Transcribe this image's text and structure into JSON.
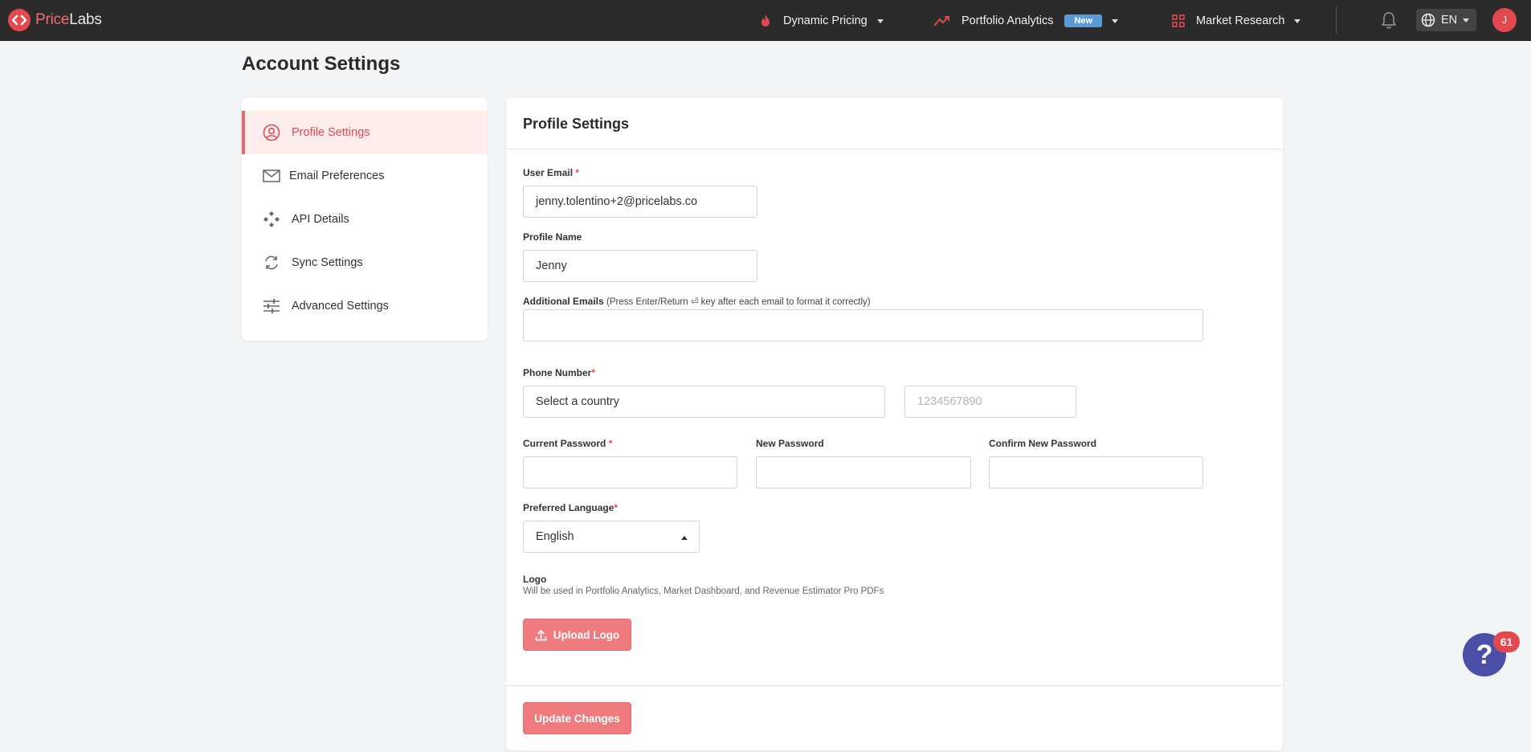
{
  "header": {
    "logo_part1": "Price",
    "logo_part2": "Labs",
    "nav": [
      {
        "label": "Dynamic Pricing",
        "icon": "flame-icon"
      },
      {
        "label": "Portfolio Analytics",
        "icon": "trend-icon",
        "badge": "New"
      },
      {
        "label": "Market Research",
        "icon": "grid-icon"
      }
    ],
    "language": "EN",
    "avatar_initial": "J"
  },
  "page_title": "Account Settings",
  "sidebar": {
    "items": [
      {
        "label": "Profile Settings",
        "icon": "user-circle-icon",
        "active": true
      },
      {
        "label": "Email Preferences",
        "icon": "envelope-icon"
      },
      {
        "label": "API Details",
        "icon": "api-icon"
      },
      {
        "label": "Sync Settings",
        "icon": "sync-icon"
      },
      {
        "label": "Advanced Settings",
        "icon": "sliders-icon"
      }
    ]
  },
  "form": {
    "title": "Profile Settings",
    "user_email": {
      "label": "User Email",
      "required": "*",
      "value": "jenny.tolentino+2@pricelabs.co"
    },
    "profile_name": {
      "label": "Profile Name",
      "value": "Jenny"
    },
    "additional_emails": {
      "label": "Additional Emails",
      "hint": "(Press Enter/Return ⏎ key after each email to format it correctly)",
      "value": ""
    },
    "phone": {
      "label": "Phone Number",
      "required": "*",
      "country_value": "Select a country",
      "number_placeholder": "1234567890"
    },
    "current_password": {
      "label": "Current Password",
      "required": "*"
    },
    "new_password": {
      "label": "New Password"
    },
    "confirm_password": {
      "label": "Confirm New Password"
    },
    "preferred_language": {
      "label": "Preferred Language",
      "required": "*",
      "value": "English"
    },
    "logo": {
      "label": "Logo",
      "description": "Will be used in Portfolio Analytics, Market Dashboard, and Revenue Estimator Pro PDFs",
      "button": "Upload Logo"
    },
    "update_button": "Update Changes"
  },
  "help": {
    "count": "61",
    "symbol": "?"
  },
  "colors": {
    "brand": "#e4484f",
    "button": "#ef7b7f",
    "active_bg": "#fdeeed",
    "topbar": "#2b2b2b",
    "help": "#4b4fa8",
    "badge_new": "#5b9bd5"
  }
}
